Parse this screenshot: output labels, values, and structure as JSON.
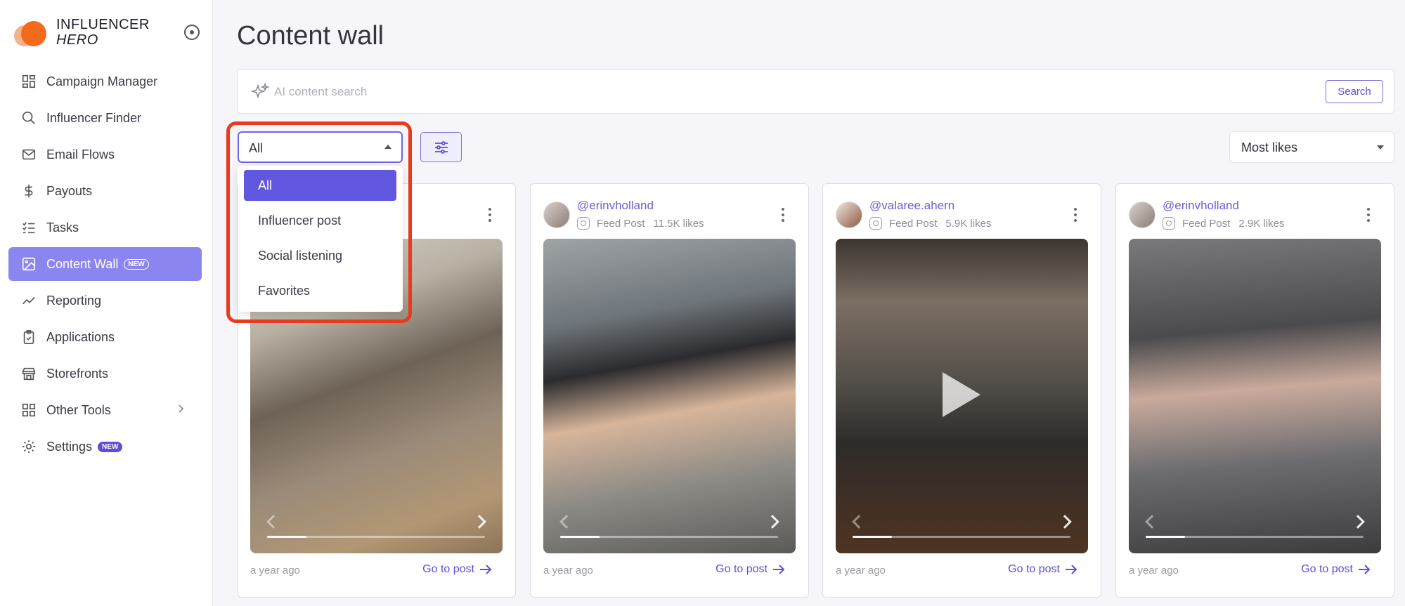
{
  "brand": {
    "line1": "INFLUENCER",
    "line2": "HERO"
  },
  "sidebar": {
    "items": [
      {
        "label": "Campaign Manager",
        "icon": "grid-icon"
      },
      {
        "label": "Influencer Finder",
        "icon": "search-icon"
      },
      {
        "label": "Email Flows",
        "icon": "mail-icon"
      },
      {
        "label": "Payouts",
        "icon": "dollar-icon"
      },
      {
        "label": "Tasks",
        "icon": "checklist-icon"
      },
      {
        "label": "Content Wall",
        "icon": "image-icon",
        "badge": "NEW",
        "active": true
      },
      {
        "label": "Reporting",
        "icon": "trend-icon"
      },
      {
        "label": "Applications",
        "icon": "clipboard-icon"
      },
      {
        "label": "Storefronts",
        "icon": "store-icon"
      },
      {
        "label": "Other Tools",
        "icon": "grid-tools-icon"
      },
      {
        "label": "Settings",
        "icon": "gear-icon",
        "badge": "NEW"
      }
    ]
  },
  "main": {
    "title": "Content wall",
    "search": {
      "placeholder": "AI content search",
      "button": "Search"
    },
    "filter": {
      "selected": "All",
      "options": [
        "All",
        "Influencer post",
        "Social listening",
        "Favorites"
      ]
    },
    "sort": {
      "selected": "Most likes"
    }
  },
  "cards": [
    {
      "handle": "",
      "type": "",
      "likes": "",
      "time": "a year ago",
      "link": "Go to post"
    },
    {
      "handle": "@erinvholland",
      "type": "Feed Post",
      "likes": "11.5K likes",
      "time": "a year ago",
      "link": "Go to post"
    },
    {
      "handle": "@valaree.ahern",
      "type": "Feed Post",
      "likes": "5.9K likes",
      "time": "a year ago",
      "link": "Go to post"
    },
    {
      "handle": "@erinvholland",
      "type": "Feed Post",
      "likes": "2.9K likes",
      "time": "a year ago",
      "link": "Go to post"
    }
  ],
  "colors": {
    "accent": "#6257e0",
    "active_nav": "#8b86ef",
    "highlight": "#ea3a1e"
  }
}
